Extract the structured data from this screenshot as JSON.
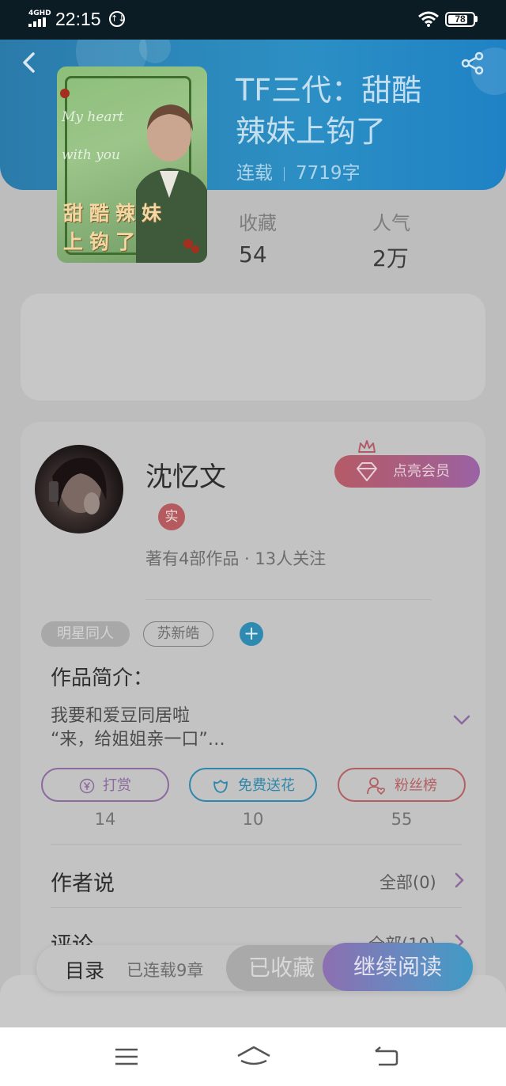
{
  "status_bar": {
    "network": "4GHD",
    "time": "22:15",
    "data_badge": "↑↓",
    "battery": "78"
  },
  "book": {
    "title_line1": "TF三代：甜酷",
    "title_line2": "辣妹上钩了",
    "status": "连载",
    "word_count": "7719字",
    "cover_script": "My heart with you",
    "cover_title": "甜酷辣妹上钩了",
    "stats": [
      {
        "label": "收藏",
        "value": "54"
      },
      {
        "label": "人气",
        "value": "2万"
      }
    ]
  },
  "author": {
    "name": "沈忆文",
    "verified_badge": "实",
    "summary": "著有4部作品 · 13人关注",
    "vip_button": "点亮会员"
  },
  "tags": {
    "primary": "明星同人",
    "secondary": "苏新皓",
    "add": "+"
  },
  "intro": {
    "heading": "作品简介：",
    "line1": "我要和爱豆同居啦",
    "line2": "“来，给姐姐亲一口”…"
  },
  "actions": [
    {
      "label": "打赏",
      "icon": "yen-icon",
      "count": "14"
    },
    {
      "label": "免费送花",
      "icon": "flower-icon",
      "count": "10"
    },
    {
      "label": "粉丝榜",
      "icon": "fans-icon",
      "count": "55"
    }
  ],
  "author_says": {
    "title": "作者说",
    "link": "全部(0)"
  },
  "comments": {
    "title": "评论",
    "link": "全部(10)"
  },
  "bottom_bar": {
    "toc": "目录",
    "toc_count": "已连载9章",
    "collected": "已收藏",
    "continue": "继续阅读"
  },
  "colors": {
    "header": "#2c8fc4",
    "accent_blue": "#2f86ab",
    "accent_red": "#b35f62",
    "accent_purple": "#8b6a9e"
  }
}
